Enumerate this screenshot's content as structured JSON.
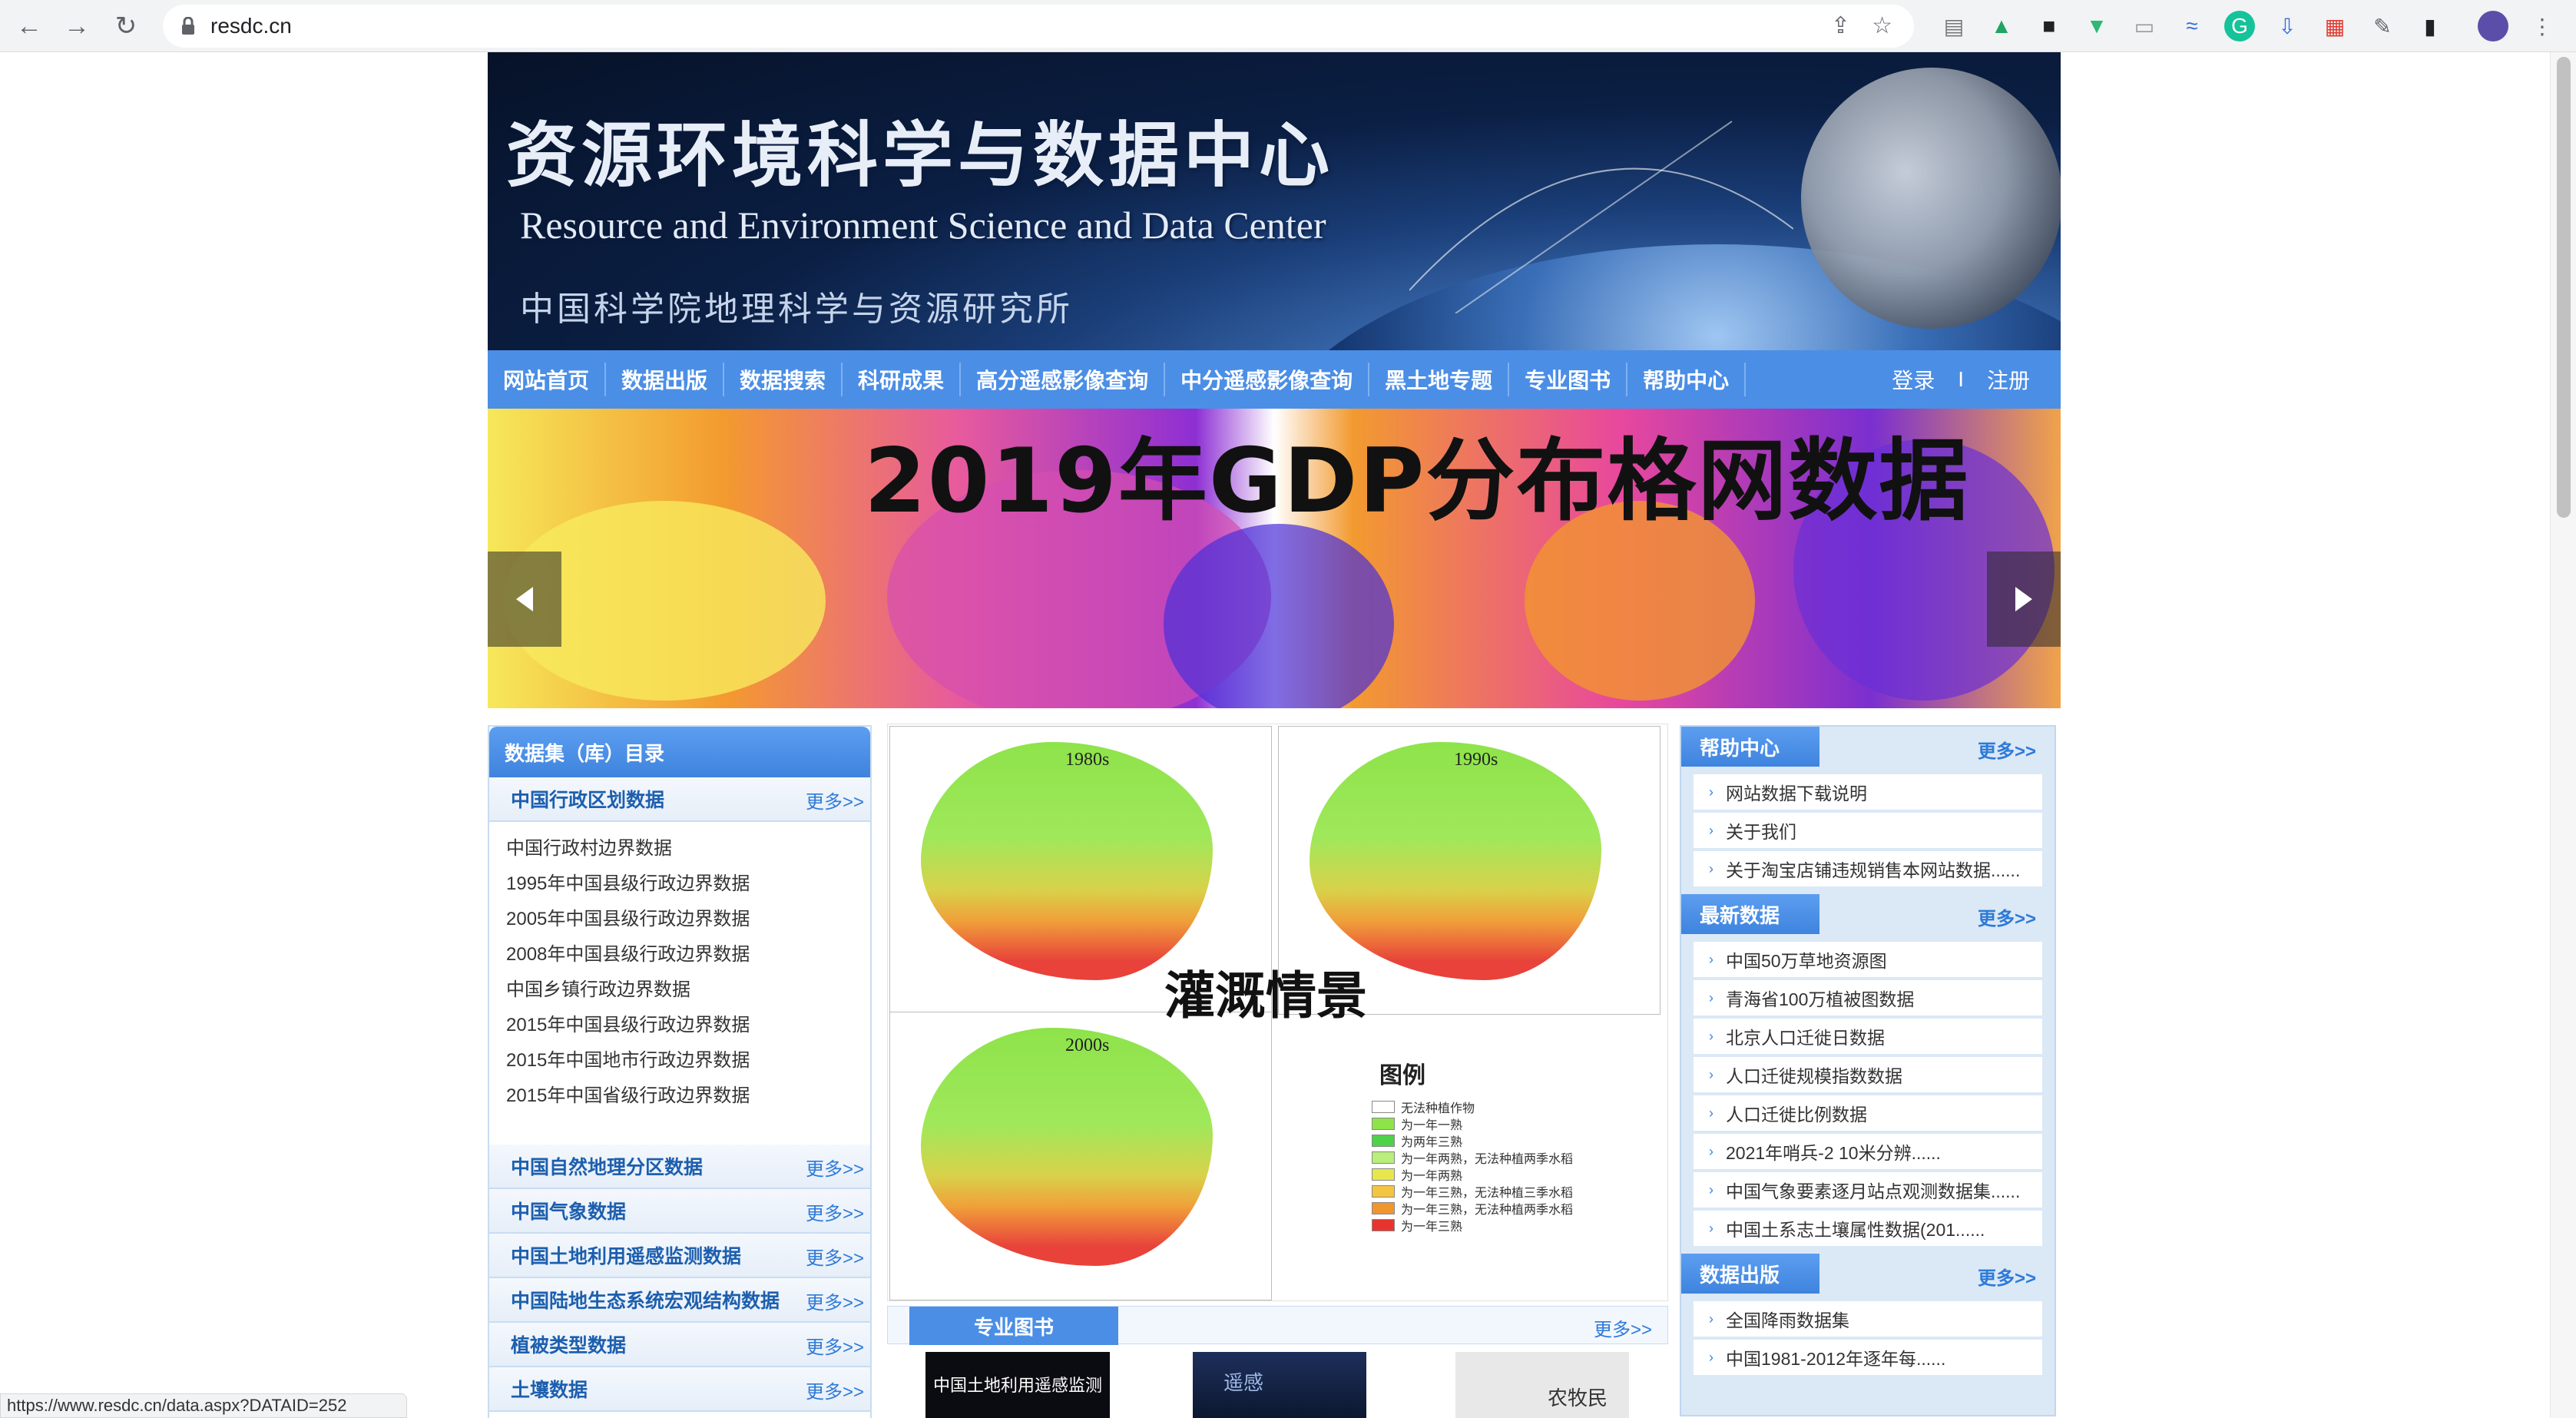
{
  "browser": {
    "url": "resdc.cn",
    "status_url": "https://www.resdc.cn/data.aspx?DATAID=252",
    "icons": [
      "back-icon",
      "forward-icon",
      "reload-icon",
      "lock-icon",
      "share-icon",
      "bookmark-star-icon",
      "extensions-icon",
      "sidebar-icon",
      "profile-avatar",
      "menu-icon"
    ]
  },
  "header": {
    "title_cn": "资源环境科学与数据中心",
    "title_en": "Resource and Environment Science and Data Center",
    "subtitle": "中国科学院地理科学与资源研究所"
  },
  "nav": {
    "items": [
      "网站首页",
      "数据出版",
      "数据搜索",
      "科研成果",
      "高分遥感影像查询",
      "中分遥感影像查询",
      "黑土地专题",
      "专业图书",
      "帮助中心"
    ],
    "login": "登录",
    "divider": "I",
    "register": "注册"
  },
  "slider": {
    "title": "2019年GDP分布格网数据",
    "colors": [
      "#f6e85a",
      "#f39a2f",
      "#e75a9d",
      "#8e2fd4"
    ]
  },
  "left": {
    "header": "数据集（库）目录",
    "more": "更多>>",
    "section1": "中国行政区划数据",
    "section1_items": [
      "中国行政村边界数据",
      "1995年中国县级行政边界数据",
      "2005年中国县级行政边界数据",
      "2008年中国县级行政边界数据",
      "中国乡镇行政边界数据",
      "2015年中国县级行政边界数据",
      "2015年中国地市行政边界数据",
      "2015年中国省级行政边界数据"
    ],
    "sections": [
      "中国自然地理分区数据",
      "中国气象数据",
      "中国土地利用遥感监测数据",
      "中国陆地生态系统宏观结构数据",
      "植被类型数据",
      "土壤数据"
    ]
  },
  "middle": {
    "map_labels": [
      "1980s",
      "1990s",
      "2000s"
    ],
    "caption": "灌溉情景",
    "legend_title": "图例",
    "legend": [
      {
        "label": "无法种植作物",
        "color": "#ffffff"
      },
      {
        "label": "为一年一熟",
        "color": "#8ee34a"
      },
      {
        "label": "为两年三熟",
        "color": "#4dd24a"
      },
      {
        "label": "为一年两熟，无法种植两季水稻",
        "color": "#b8ee7a"
      },
      {
        "label": "为一年两熟",
        "color": "#e7e64e"
      },
      {
        "label": "为一年三熟，无法种植三季水稻",
        "color": "#f4c542"
      },
      {
        "label": "为一年三熟，无法种植两季水稻",
        "color": "#f0962f"
      },
      {
        "label": "为一年三熟",
        "color": "#e8342e"
      }
    ],
    "books_tab": "专业图书",
    "books_more": "更多>>",
    "book_titles": [
      "中国土地利用遥感监测",
      "遥感",
      "农牧民"
    ]
  },
  "right": {
    "help": {
      "title": "帮助中心",
      "more": "更多>>",
      "items": [
        "网站数据下载说明",
        "关于我们",
        "关于淘宝店铺违规销售本网站数据......"
      ]
    },
    "latest": {
      "title": "最新数据",
      "more": "更多>>",
      "items": [
        "中国50万草地资源图",
        "青海省100万植被图数据",
        "北京人口迁徙日数据",
        "人口迁徙规模指数数据",
        "人口迁徙比例数据",
        "2021年哨兵-2 10米分辨......",
        "中国气象要素逐月站点观测数据集......",
        "中国土系志土壤属性数据(201......"
      ]
    },
    "publish": {
      "title": "数据出版",
      "more": "更多>>",
      "items": [
        "全国降雨数据集",
        "中国1981-2012年逐年每......"
      ]
    }
  },
  "colors": {
    "nav_blue": "#4b8ee6",
    "link_blue": "#2f7ad8",
    "panel_bg": "#dbe8f6"
  }
}
